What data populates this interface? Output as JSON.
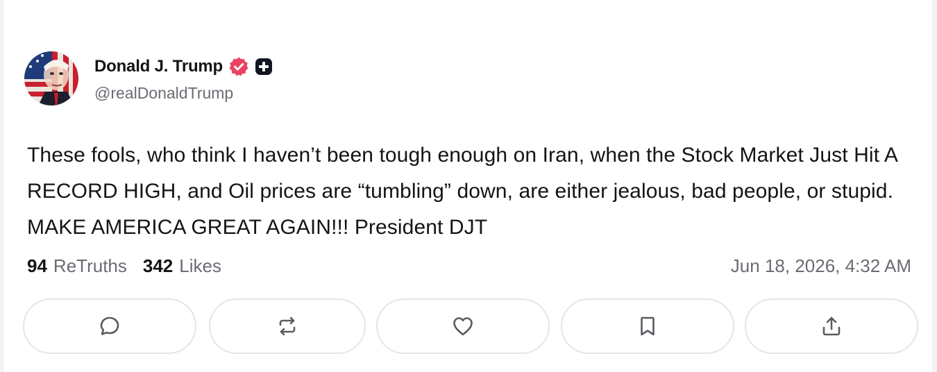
{
  "post": {
    "author": {
      "display_name": "Donald J. Trump",
      "handle": "@realDonaldTrump",
      "verified_badge_color": "#e8435f"
    },
    "text": "These fools, who think I haven’t been tough enough on Iran, when the Stock Market Just Hit A RECORD HIGH, and Oil prices are “tumbling” down, are either jealous, bad people, or stupid. MAKE AMERICA GREAT AGAIN!!! President DJT",
    "stats": {
      "retruths_count": "94",
      "retruths_label": "ReTruths",
      "likes_count": "342",
      "likes_label": "Likes"
    },
    "timestamp": "Jun 18, 2026, 4:32 AM"
  },
  "actions": [
    {
      "icon": "comment-icon"
    },
    {
      "icon": "retruth-icon"
    },
    {
      "icon": "heart-icon"
    },
    {
      "icon": "bookmark-icon"
    },
    {
      "icon": "share-icon"
    }
  ],
  "colors": {
    "text_primary": "#141414",
    "text_secondary": "#6b6b73",
    "border": "#e5e5e8",
    "icon": "#5a5a62"
  }
}
